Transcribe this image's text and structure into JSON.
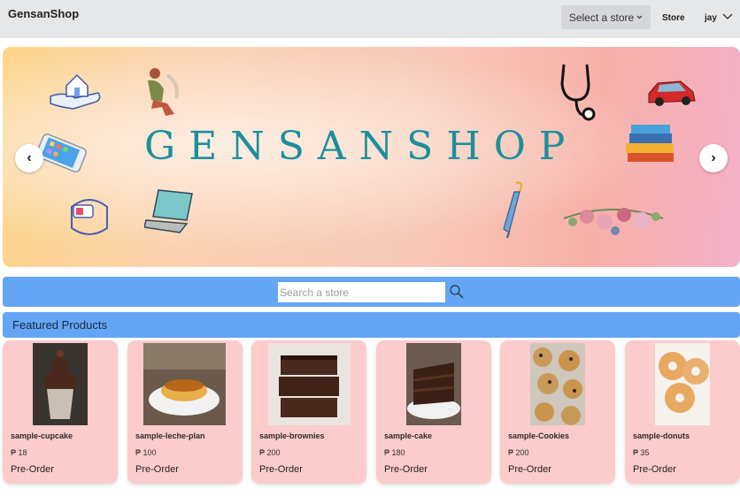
{
  "navbar": {
    "brand": "GensanShop",
    "select_store_label": "Select a store",
    "store_link": "Store",
    "user_name": "jay"
  },
  "hero": {
    "title": "GENSANSHOP",
    "prev_label": "‹",
    "next_label": "›"
  },
  "search": {
    "placeholder": "Search a store",
    "value": ""
  },
  "featured": {
    "title": "Featured Products"
  },
  "products": [
    {
      "name": "sample-cupcake",
      "price": "₱ 18",
      "action": "Pre-Order"
    },
    {
      "name": "sample-leche-plan",
      "price": "₱ 100",
      "action": "Pre-Order"
    },
    {
      "name": "sample-brownies",
      "price": "₱ 200",
      "action": "Pre-Order"
    },
    {
      "name": "sample-cake",
      "price": "₱ 180",
      "action": "Pre-Order"
    },
    {
      "name": "sample-Cookies",
      "price": "₱ 200",
      "action": "Pre-Order"
    },
    {
      "name": "sample-donuts",
      "price": "₱ 35",
      "action": "Pre-Order"
    }
  ],
  "colors": {
    "navbar_bg": "#e6e7e8",
    "bar_blue": "#64a5f5",
    "card_pink": "#fccbcb",
    "hero_title": "#1d8f9c"
  }
}
